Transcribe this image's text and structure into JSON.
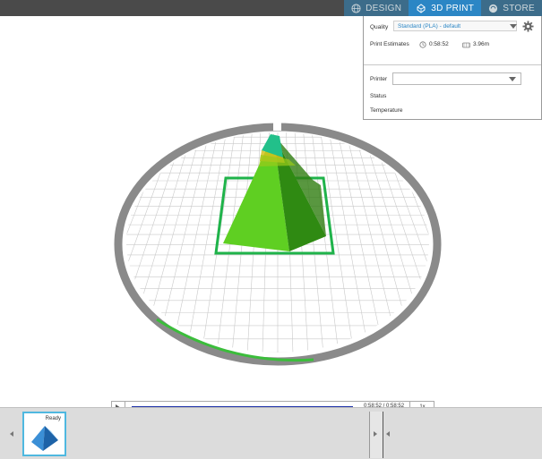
{
  "tabs": [
    {
      "label": "DESIGN",
      "icon": "globe-icon",
      "active": false
    },
    {
      "label": "3D PRINT",
      "icon": "print-3d-icon",
      "active": true
    },
    {
      "label": "STORE",
      "icon": "store-icon",
      "active": false
    }
  ],
  "panel": {
    "quality_label": "Quality",
    "quality_value": "Standard (PLA)  -  default",
    "estimates_label": "Print Estimates",
    "time_estimate": "0:58:52",
    "filament_estimate": "3.96m",
    "printer_label": "Printer",
    "printer_value": "",
    "status_label": "Status",
    "temperature_label": "Temperature"
  },
  "playback": {
    "time": "0:58:52 / 0:58:52",
    "speed": "1x",
    "progress": 1.0
  },
  "thumbnails": [
    {
      "label": "Ready",
      "icon": "pyramid-model-icon"
    }
  ],
  "colors": {
    "accent": "#2b86c5",
    "model": "#4caf2a",
    "progress": "#1b2fa8",
    "selection": "#4fb8e0"
  }
}
